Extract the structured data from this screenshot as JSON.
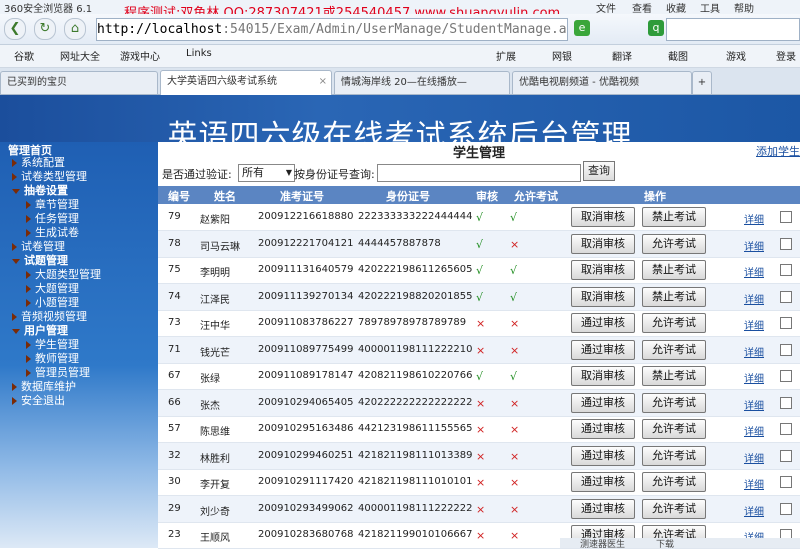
{
  "browser": {
    "app_name": "360安全浏览器 6.1",
    "watermark": "程序测试:双鱼林 QQ:287307421或254540457 www.shuangyulin.com",
    "menu": [
      "文件",
      "查看",
      "收藏",
      "工具",
      "帮助"
    ],
    "url_host": "http://localhost",
    "url_path": ":54015/Exam/Admin/UserManage/StudentManage.aspx",
    "favorites": [
      "谷歌",
      "网址大全",
      "游戏中心",
      "Links"
    ],
    "toolbar_right": [
      "扩展",
      "网银",
      "翻译",
      "截图",
      "游戏",
      "登录"
    ],
    "tabs": [
      "已买到的宝贝",
      "大学英语四六级考试系统",
      "情城海岸线 20—在线播放—",
      "优酷电视剧频道 - 优酷视频"
    ],
    "status": [
      "测速器医生",
      "下载"
    ]
  },
  "banner_title": "英语四六级在线考试系统后台管理",
  "sidebar": {
    "home": "管理首页",
    "items": [
      {
        "label": "系统配置",
        "level": 1,
        "expanded": false
      },
      {
        "label": "试卷类型管理",
        "level": 1,
        "expanded": false
      },
      {
        "label": "抽卷设置",
        "level": 1,
        "expanded": true
      },
      {
        "label": "章节管理",
        "level": 2
      },
      {
        "label": "任务管理",
        "level": 2
      },
      {
        "label": "生成试卷",
        "level": 2
      },
      {
        "label": "试卷管理",
        "level": 1,
        "expanded": false
      },
      {
        "label": "试题管理",
        "level": 1,
        "expanded": true
      },
      {
        "label": "大题类型管理",
        "level": 2
      },
      {
        "label": "大题管理",
        "level": 2
      },
      {
        "label": "小题管理",
        "level": 2
      },
      {
        "label": "音频视频管理",
        "level": 1,
        "expanded": false
      },
      {
        "label": "用户管理",
        "level": 1,
        "expanded": true
      },
      {
        "label": "学生管理",
        "level": 2
      },
      {
        "label": "教师管理",
        "level": 2
      },
      {
        "label": "管理员管理",
        "level": 2
      },
      {
        "label": "数据库维护",
        "level": 1,
        "expanded": false
      },
      {
        "label": "安全退出",
        "level": 1,
        "expanded": false
      }
    ]
  },
  "page": {
    "title": "学生管理",
    "add_link": "添加学生",
    "filter_label": "是否通过验证:",
    "filter_value": "所有",
    "id_query_label": "按身份证号查询:",
    "query_button": "查询"
  },
  "table": {
    "headers": [
      "编号",
      "姓名",
      "准考证号",
      "身份证号",
      "审核",
      "允许考试",
      "操作"
    ],
    "detail_label": "详细",
    "rows": [
      [
        "79",
        "赵紫阳",
        "200912216618880",
        "222333333222444444",
        "√",
        "√",
        "取消审核",
        "禁止考试"
      ],
      [
        "78",
        "司马云琳",
        "200912221704121",
        "4444457887878",
        "√",
        "×",
        "取消审核",
        "允许考试"
      ],
      [
        "75",
        "李明明",
        "200911131640579",
        "420222198611265605",
        "√",
        "√",
        "取消审核",
        "禁止考试"
      ],
      [
        "74",
        "江泽民",
        "200911139270134",
        "420222198820201855",
        "√",
        "√",
        "取消审核",
        "禁止考试"
      ],
      [
        "73",
        "汪中华",
        "200911083786227",
        "78978978978789789",
        "×",
        "×",
        "通过审核",
        "允许考试"
      ],
      [
        "71",
        "钱光芒",
        "200911089775499",
        "400001198111222210",
        "×",
        "×",
        "通过审核",
        "允许考试"
      ],
      [
        "67",
        "张绿",
        "200911089178147",
        "420821198610220766",
        "√",
        "√",
        "取消审核",
        "禁止考试"
      ],
      [
        "66",
        "张杰",
        "200910294065405",
        "420222222222222222",
        "×",
        "×",
        "通过审核",
        "允许考试"
      ],
      [
        "57",
        "陈思维",
        "200910295163486",
        "442123198611155565",
        "×",
        "×",
        "通过审核",
        "允许考试"
      ],
      [
        "32",
        "林胜利",
        "200910299460251",
        "421821198111013389",
        "×",
        "×",
        "通过审核",
        "允许考试"
      ],
      [
        "30",
        "李开复",
        "200910291117420",
        "421821198111010101",
        "×",
        "×",
        "通过审核",
        "允许考试"
      ],
      [
        "29",
        "刘少奇",
        "200910293499062",
        "400001198111222222",
        "×",
        "×",
        "通过审核",
        "允许考试"
      ],
      [
        "23",
        "王顺风",
        "200910283680768",
        "421821199010106667",
        "×",
        "×",
        "通过审核",
        "允许考试"
      ]
    ]
  }
}
